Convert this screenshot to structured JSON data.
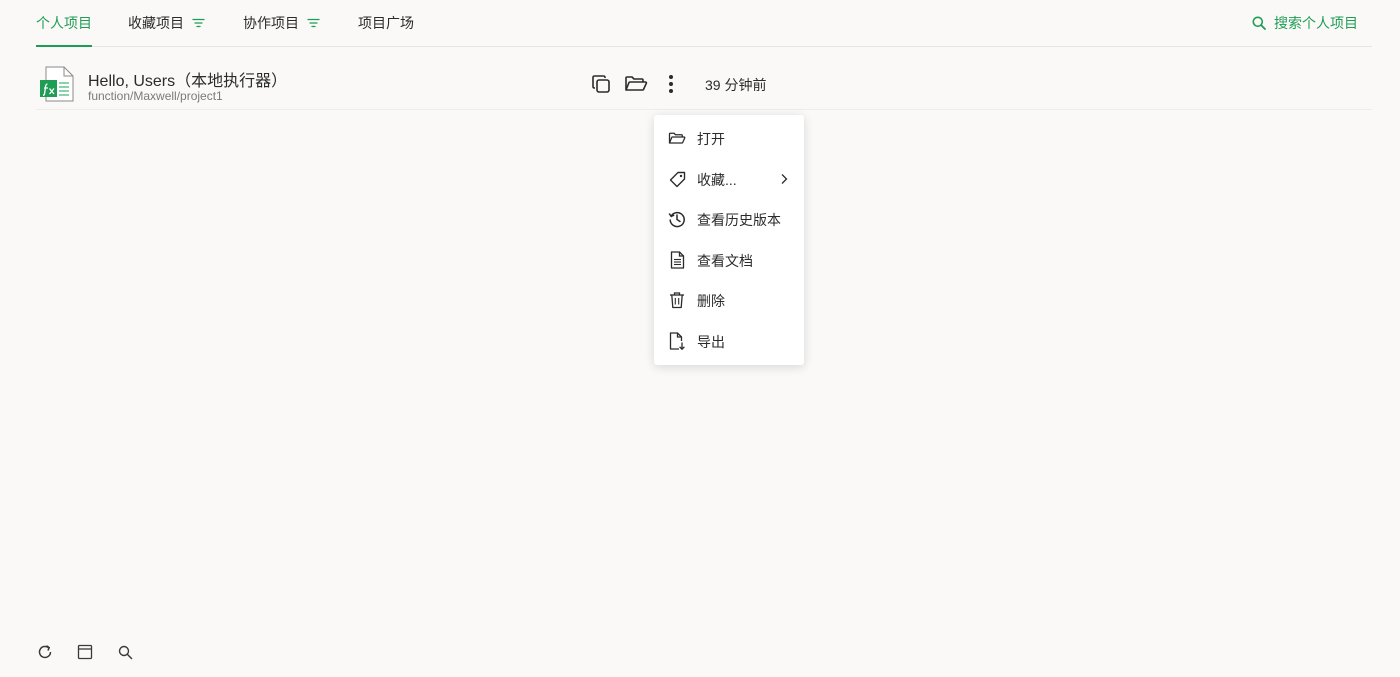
{
  "tabs": [
    {
      "label": "个人项目",
      "active": true
    },
    {
      "label": "收藏项目",
      "active": false
    },
    {
      "label": "协作项目",
      "active": false
    },
    {
      "label": "项目广场",
      "active": false
    }
  ],
  "search": {
    "label": "搜索个人项目"
  },
  "project": {
    "title": "Hello, Users（本地执行器）",
    "path": "function/Maxwell/project1",
    "time": "39 分钟前"
  },
  "menu": {
    "items": [
      {
        "label": "打开",
        "icon": "folder-open-icon"
      },
      {
        "label": "收藏...",
        "icon": "tag-icon"
      },
      {
        "label": "查看历史版本",
        "icon": "history-icon"
      },
      {
        "label": "查看文档",
        "icon": "document-icon"
      },
      {
        "label": "删除",
        "icon": "trash-icon"
      },
      {
        "label": "导出",
        "icon": "export-icon"
      }
    ]
  },
  "colors": {
    "accent": "#1f9d55",
    "background": "#faf9f7",
    "text": "#2b2b2b",
    "muted": "#7a7a7a"
  }
}
